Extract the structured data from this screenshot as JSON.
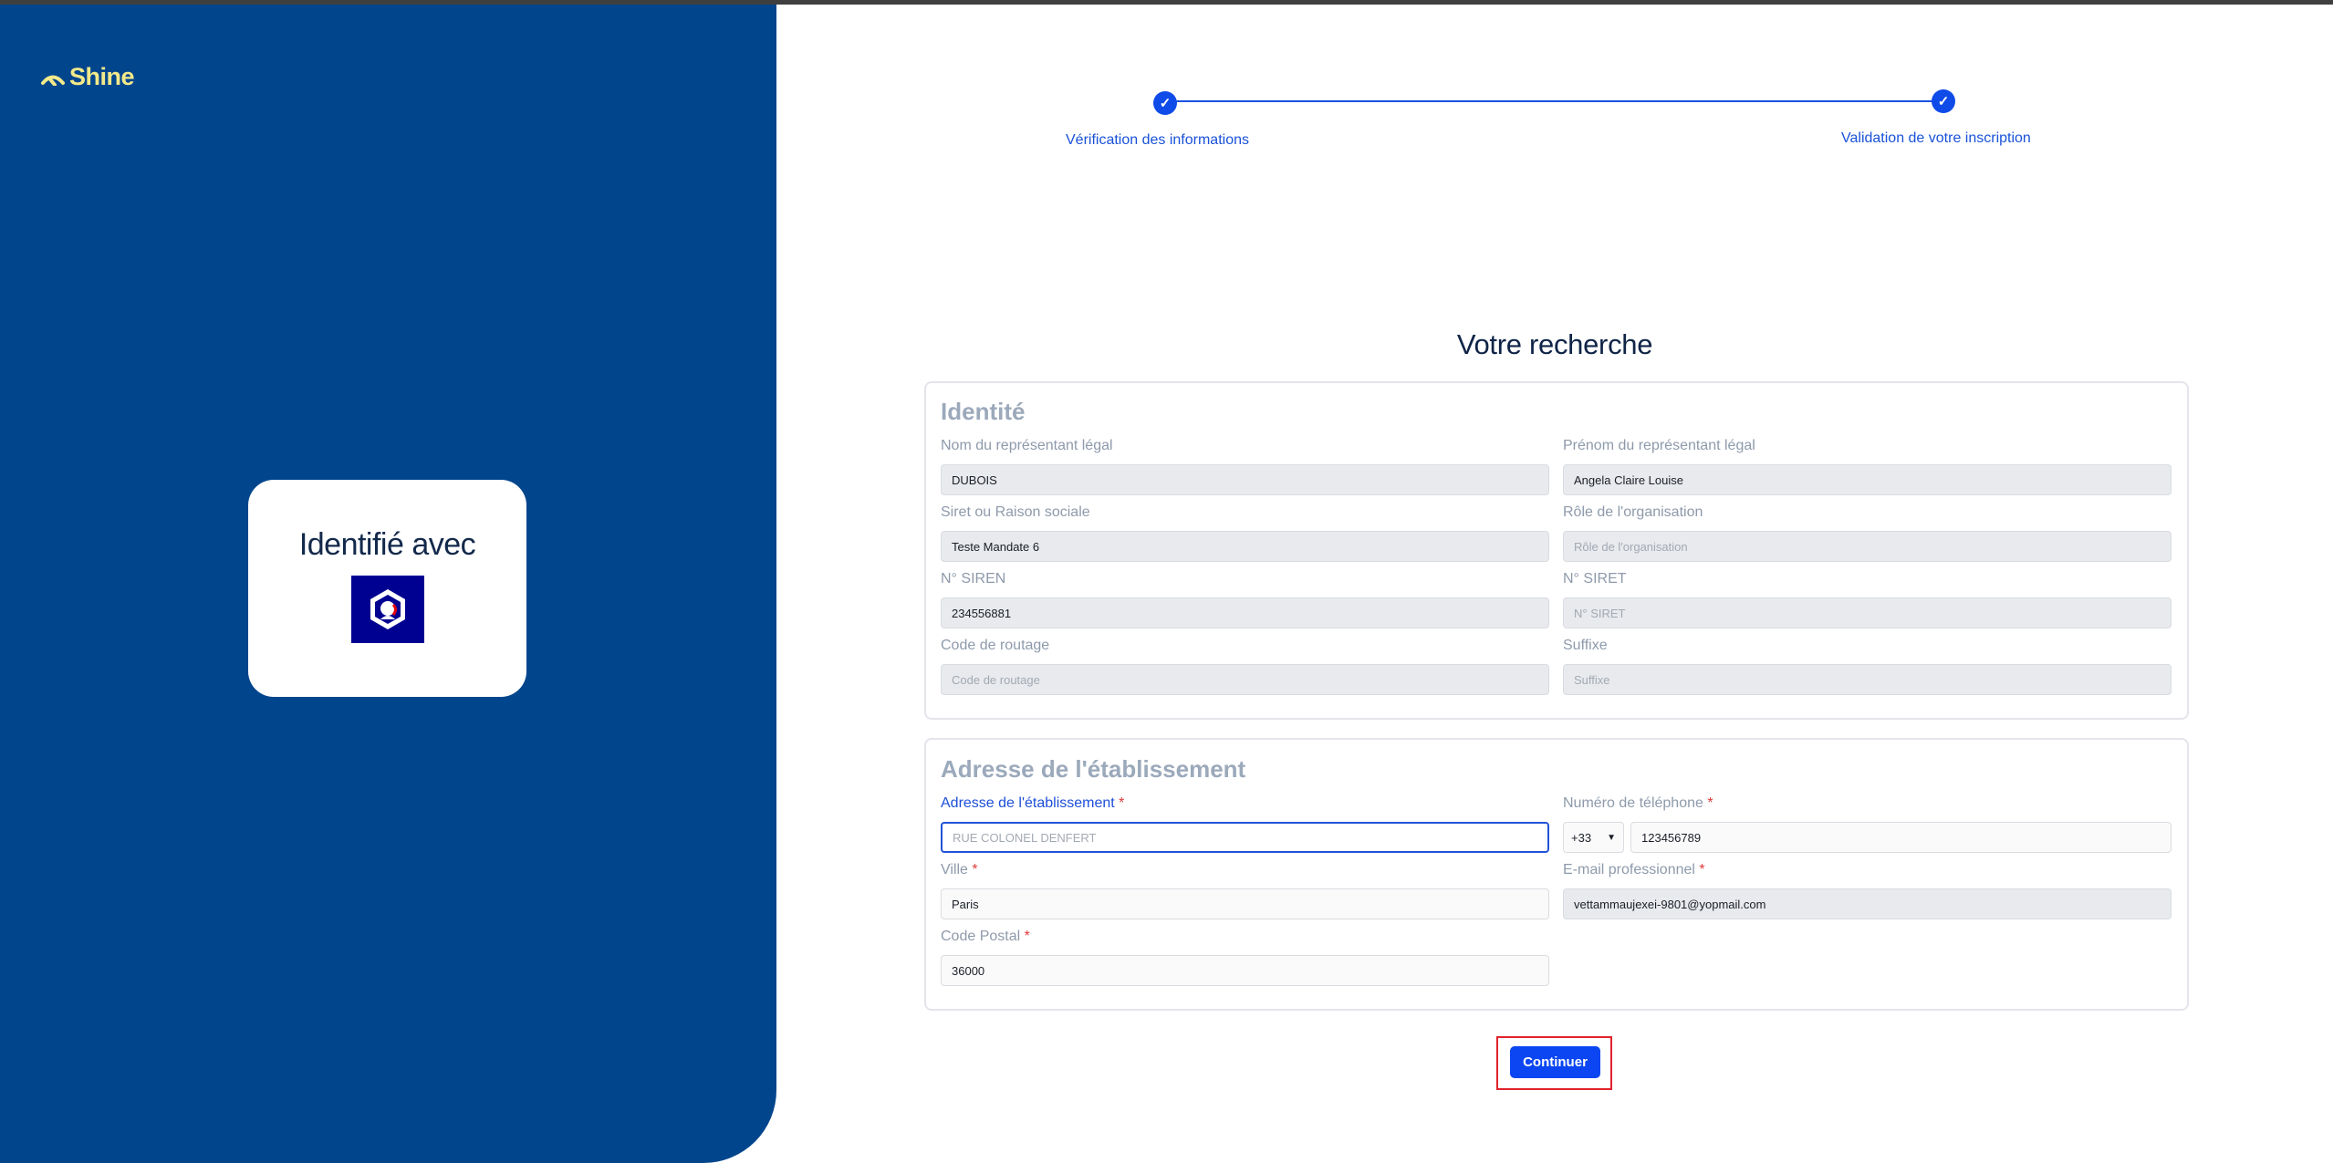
{
  "brand": {
    "name": "Shine",
    "logo_color": "#f3e98a",
    "panel_color": "#01458d"
  },
  "identity_card": {
    "title": "Identifié avec",
    "provider_icon": "franceconnect-logo-icon"
  },
  "stepper": {
    "steps": [
      {
        "label": "Vérification des informations",
        "status": "completed"
      },
      {
        "label": "Validation de votre inscription",
        "status": "completed"
      }
    ],
    "accent": "#0f4be8"
  },
  "page_title": "Votre recherche",
  "identity": {
    "title": "Identité",
    "fields": {
      "nom": {
        "label": "Nom du représentant légal",
        "value": "DUBOIS"
      },
      "prenom": {
        "label": "Prénom du représentant légal",
        "value": "Angela Claire Louise"
      },
      "siret_raison": {
        "label": "Siret ou Raison sociale",
        "value": "Teste Mandate 6"
      },
      "role": {
        "label": "Rôle de l'organisation",
        "placeholder": "Rôle de l'organisation"
      },
      "siren": {
        "label": "N° SIREN",
        "value": "234556881"
      },
      "siret": {
        "label": "N° SIRET",
        "placeholder": "N° SIRET"
      },
      "code_routage": {
        "label": "Code de routage",
        "placeholder": "Code de routage"
      },
      "suffixe": {
        "label": "Suffixe",
        "placeholder": "Suffixe"
      }
    }
  },
  "address": {
    "title": "Adresse de l'établissement",
    "required_mark": "*",
    "fields": {
      "adresse": {
        "label": "Adresse de l'établissement",
        "placeholder": "RUE COLONEL DENFERT"
      },
      "telephone": {
        "label": "Numéro de téléphone",
        "country_code": "+33",
        "value": "123456789"
      },
      "ville": {
        "label": "Ville",
        "value": "Paris"
      },
      "email": {
        "label": "E-mail professionnel",
        "value": "vettammaujexei-9801@yopmail.com"
      },
      "code_postal": {
        "label": "Code Postal",
        "value": "36000"
      }
    }
  },
  "continue_button": {
    "label": "Continuer",
    "color": "#0b46f2"
  }
}
